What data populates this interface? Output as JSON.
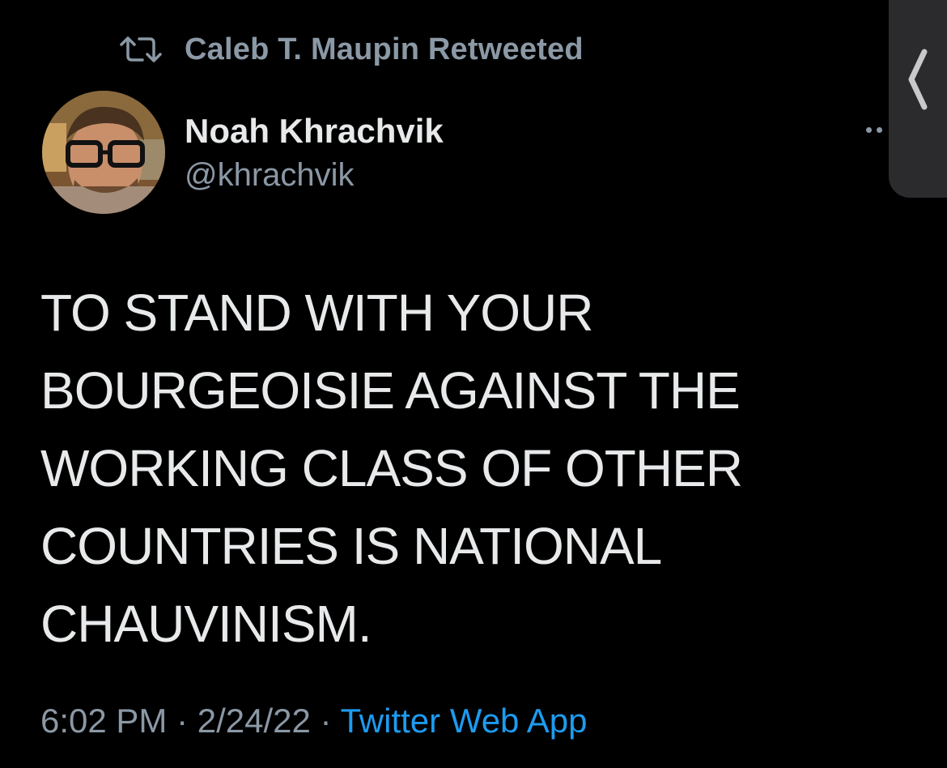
{
  "retweet": {
    "icon": "retweet-icon",
    "label": "Caleb T. Maupin Retweeted"
  },
  "author": {
    "display_name": "Noah Khrachvik",
    "handle": "@khrachvik",
    "avatar_icon": "avatar-photo"
  },
  "tweet": {
    "lines": [
      "TO STAND WITH YOUR",
      "BOURGEOISIE AGAINST THE",
      "WORKING CLASS OF OTHER",
      "COUNTRIES IS NATIONAL",
      "CHAUVINISM."
    ]
  },
  "meta": {
    "time": "6:02 PM",
    "separator": " · ",
    "date": "2/24/22",
    "source": "Twitter Web App"
  },
  "ui": {
    "more_icon": "more-options-icon",
    "side_handle_icon": "chevron-left-icon"
  },
  "colors": {
    "background": "#000000",
    "primary_text": "#e7e9ea",
    "secondary_text": "#8b98a5",
    "link": "#1d9bf0",
    "side_handle": "#2b2b2d"
  }
}
